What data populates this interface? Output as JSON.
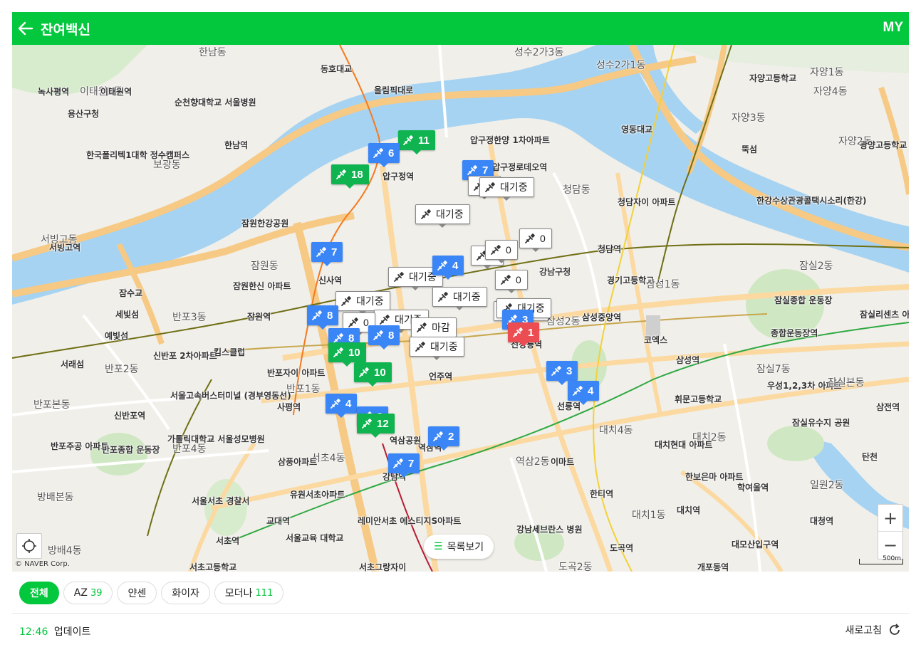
{
  "header": {
    "title": "잔여백신",
    "my_label": "MY",
    "back_icon": "arrow-left-icon"
  },
  "map": {
    "copyright": "© NAVER Corp.",
    "scale_label": "500m",
    "list_button_label": "목록보기",
    "labels": [
      {
        "text": "한남동",
        "big": true
      },
      {
        "text": "이태원1동",
        "big": true
      },
      {
        "text": "녹사평역"
      },
      {
        "text": "이태원역"
      },
      {
        "text": "순천향대학교 서울병원"
      },
      {
        "text": "용산구청"
      },
      {
        "text": "한남역"
      },
      {
        "text": "한국폴리텍1대학 정수캠퍼스"
      },
      {
        "text": "보광동",
        "big": true
      },
      {
        "text": "동호대교"
      },
      {
        "text": "올림픽대로"
      },
      {
        "text": "압구정역"
      },
      {
        "text": "압구정한양 1차아파트"
      },
      {
        "text": "압구정로데오역"
      },
      {
        "text": "청담동",
        "big": true
      },
      {
        "text": "영동대교"
      },
      {
        "text": "청담자이 아파트"
      },
      {
        "text": "성수2가1동",
        "big": true
      },
      {
        "text": "성수2가3동",
        "big": true
      },
      {
        "text": "자양1동",
        "big": true
      },
      {
        "text": "자양4동",
        "big": true
      },
      {
        "text": "자양3동",
        "big": true
      },
      {
        "text": "자양2동",
        "big": true
      },
      {
        "text": "자양고등학교"
      },
      {
        "text": "광양고등학교"
      },
      {
        "text": "뚝섬"
      },
      {
        "text": "한강수상관광콜택시소리(한강)"
      },
      {
        "text": "잠원한강공원"
      },
      {
        "text": "서빙고동",
        "big": true
      },
      {
        "text": "서빙고역"
      },
      {
        "text": "잠원동",
        "big": true
      },
      {
        "text": "신사역"
      },
      {
        "text": "잠원한신 아파트"
      },
      {
        "text": "잠원역"
      },
      {
        "text": "반포3동",
        "big": true
      },
      {
        "text": "세빛섬"
      },
      {
        "text": "예빛섬"
      },
      {
        "text": "잠수교"
      },
      {
        "text": "청담역"
      },
      {
        "text": "강남구청"
      },
      {
        "text": "경기고등학교"
      },
      {
        "text": "삼성1동",
        "big": true
      },
      {
        "text": "삼성2동",
        "big": true
      },
      {
        "text": "삼성중앙역"
      },
      {
        "text": "선정릉역"
      },
      {
        "text": "코엑스"
      },
      {
        "text": "잠실종합 운동장"
      },
      {
        "text": "잠실2동",
        "big": true
      },
      {
        "text": "종합운동장역"
      },
      {
        "text": "잠실리센츠 아파트"
      },
      {
        "text": "잠실7동",
        "big": true
      },
      {
        "text": "삼성역"
      },
      {
        "text": "우성1,2,3차 아파트"
      },
      {
        "text": "잠실본동",
        "big": true
      },
      {
        "text": "잠실유수지 공원"
      },
      {
        "text": "삼전역"
      },
      {
        "text": "서래섬"
      },
      {
        "text": "반포2동",
        "big": true
      },
      {
        "text": "신반포 2차아파트"
      },
      {
        "text": "킴스클럽"
      },
      {
        "text": "반포자이 아파트"
      },
      {
        "text": "반포1동",
        "big": true
      },
      {
        "text": "서울고속버스터미널 (경부영동선)"
      },
      {
        "text": "사평역"
      },
      {
        "text": "반포본동",
        "big": true
      },
      {
        "text": "신반포역"
      },
      {
        "text": "반포주공 아파트"
      },
      {
        "text": "반포종합 운동장"
      },
      {
        "text": "가톨릭대학교 서울성모병원"
      },
      {
        "text": "반포4동",
        "big": true
      },
      {
        "text": "언주역"
      },
      {
        "text": "선릉역"
      },
      {
        "text": "휘문고등학교"
      },
      {
        "text": "대치4동",
        "big": true
      },
      {
        "text": "대치2동",
        "big": true
      },
      {
        "text": "대치현대 아파트"
      },
      {
        "text": "역삼2동",
        "big": true
      },
      {
        "text": "이마트"
      },
      {
        "text": "한보은마 아파트"
      },
      {
        "text": "학여울역"
      },
      {
        "text": "일원2동",
        "big": true
      },
      {
        "text": "탄천"
      },
      {
        "text": "한티역"
      },
      {
        "text": "대치1동",
        "big": true
      },
      {
        "text": "대치역"
      },
      {
        "text": "대청역"
      },
      {
        "text": "서초4동",
        "big": true
      },
      {
        "text": "삼풍아파트"
      },
      {
        "text": "유원서초아파트"
      },
      {
        "text": "방배본동",
        "big": true
      },
      {
        "text": "서울서초 경찰서"
      },
      {
        "text": "교대역"
      },
      {
        "text": "서초역"
      },
      {
        "text": "방배4동",
        "big": true
      },
      {
        "text": "레미안서초 에스티지S아파트"
      },
      {
        "text": "서울교육 대학교"
      },
      {
        "text": "서초고등학교"
      },
      {
        "text": "서초그랑자이"
      },
      {
        "text": "강남세브란스 병원"
      },
      {
        "text": "도곡역"
      },
      {
        "text": "도곡2동",
        "big": true
      },
      {
        "text": "개포동역"
      },
      {
        "text": "대모산입구역"
      },
      {
        "text": "역삼역"
      },
      {
        "text": "강남역"
      },
      {
        "text": "역삼공원"
      }
    ],
    "markers": [
      {
        "type": "green",
        "label": "11"
      },
      {
        "type": "blue",
        "label": "6"
      },
      {
        "type": "green",
        "label": "18"
      },
      {
        "type": "blue",
        "label": "7"
      },
      {
        "type": "white",
        "label": "대기중"
      },
      {
        "type": "white",
        "label": "0"
      },
      {
        "type": "white",
        "label": "대기중"
      },
      {
        "type": "blue",
        "label": "7"
      },
      {
        "type": "white",
        "label": "0"
      },
      {
        "type": "white",
        "label": "0"
      },
      {
        "type": "white",
        "label": "0"
      },
      {
        "type": "white",
        "label": "대기중"
      },
      {
        "type": "blue",
        "label": "4"
      },
      {
        "type": "white",
        "label": "0"
      },
      {
        "type": "white",
        "label": "대기중"
      },
      {
        "type": "white",
        "label": "대기중"
      },
      {
        "type": "white",
        "label": "대기중"
      },
      {
        "type": "white",
        "label": "대기중"
      },
      {
        "type": "blue",
        "label": "8"
      },
      {
        "type": "white",
        "label": "0"
      },
      {
        "type": "white",
        "label": "대기중"
      },
      {
        "type": "blue",
        "label": "3"
      },
      {
        "type": "red",
        "label": "1"
      },
      {
        "type": "white",
        "label": "마감"
      },
      {
        "type": "blue",
        "label": "8"
      },
      {
        "type": "blue",
        "label": "8"
      },
      {
        "type": "white",
        "label": "대기중"
      },
      {
        "type": "green",
        "label": "10"
      },
      {
        "type": "green",
        "label": "10"
      },
      {
        "type": "blue",
        "label": "3"
      },
      {
        "type": "blue",
        "label": "4"
      },
      {
        "type": "blue",
        "label": "4"
      },
      {
        "type": "blue",
        "label": "8"
      },
      {
        "type": "green",
        "label": "12"
      },
      {
        "type": "blue",
        "label": "2"
      },
      {
        "type": "blue",
        "label": "7"
      }
    ]
  },
  "filters": [
    {
      "label": "전체",
      "count": "",
      "active": true
    },
    {
      "label": "AZ",
      "count": "39",
      "active": false
    },
    {
      "label": "얀센",
      "count": "",
      "active": false
    },
    {
      "label": "화이자",
      "count": "",
      "active": false
    },
    {
      "label": "모더나",
      "count": "111",
      "active": false
    }
  ],
  "footer": {
    "time": "12:46",
    "update_label": "업데이트",
    "refresh_label": "새로고침"
  },
  "colors": {
    "brand": "#03c73c",
    "marker_blue": "#3b86f7",
    "marker_green": "#0fb450",
    "marker_red": "#ec4d53",
    "river": "#a6d3f2",
    "road": "#fbd9a0"
  }
}
